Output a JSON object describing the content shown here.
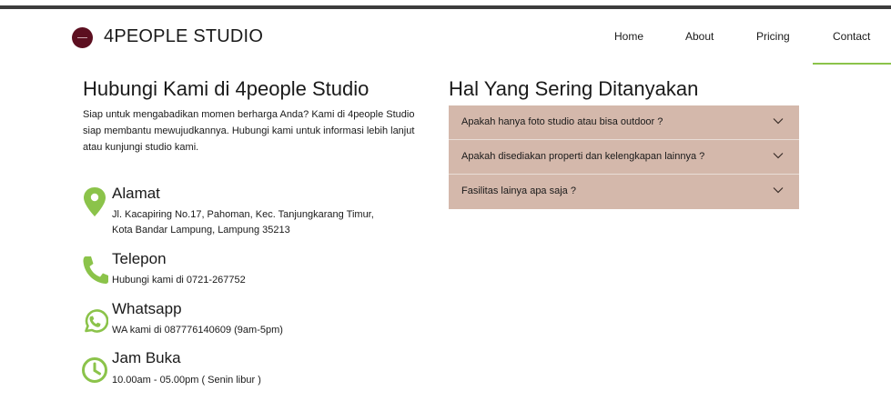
{
  "header": {
    "brand": "4PEOPLE STUDIO",
    "nav": [
      {
        "label": "Home"
      },
      {
        "label": "About"
      },
      {
        "label": "Pricing"
      },
      {
        "label": "Contact"
      }
    ],
    "active_nav": "Contact"
  },
  "contact": {
    "title": "Hubungi Kami di 4people Studio",
    "intro": "Siap untuk mengabadikan momen berharga Anda? Kami di 4people Studio siap membantu mewujudkannya. Hubungi kami untuk informasi lebih lanjut atau kunjungi studio kami.",
    "items": [
      {
        "icon": "map-pin-icon",
        "title": "Alamat",
        "lines": [
          "Jl. Kacapiring No.17, Pahoman, Kec. Tanjungkarang Timur,",
          "Kota Bandar Lampung, Lampung 35213"
        ]
      },
      {
        "icon": "phone-icon",
        "title": "Telepon",
        "lines": [
          "Hubungi kami di 0721-267752"
        ]
      },
      {
        "icon": "whatsapp-icon",
        "title": "Whatsapp",
        "lines": [
          "WA kami di 087776140609 (9am-5pm)"
        ]
      },
      {
        "icon": "clock-icon",
        "title": "Jam Buka",
        "lines": [
          "10.00am - 05.00pm ( Senin libur )"
        ]
      }
    ]
  },
  "faq": {
    "title": "Hal Yang Sering Ditanyakan",
    "items": [
      {
        "question": "Apakah hanya foto studio atau bisa outdoor ?"
      },
      {
        "question": "Apakah disediakan properti dan kelengkapan lainnya ?"
      },
      {
        "question": "Fasilitas lainya apa saja ?"
      }
    ]
  },
  "colors": {
    "accent_green": "#8bc34a",
    "faq_background": "#d4b8ab",
    "logo_maroon": "#5c0f20",
    "top_bar": "#3c3c3c"
  }
}
